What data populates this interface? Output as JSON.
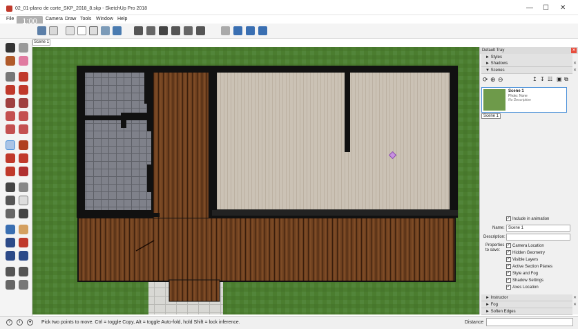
{
  "window": {
    "title": "02_01-plano de corte_SKP_2018_8.skp - SketchUp Pro 2018",
    "minimize": "—",
    "maximize": "☐",
    "close": "✕"
  },
  "timer": "1:00",
  "menu": [
    "File",
    "Camera",
    "Draw",
    "Tools",
    "Window",
    "Help"
  ],
  "scene_tab": "Scene 1",
  "tray": {
    "title": "Default Tray",
    "sections_top": [
      "Styles",
      "Shadows",
      "Scenes"
    ],
    "scene": {
      "name": "Scene 1",
      "photo_label": "Photo: None",
      "description": "No Description",
      "caption": "Scene 1"
    },
    "include_animation": "Include in animation",
    "name_label": "Name:",
    "name_value": "Scene 1",
    "description_label": "Description:",
    "properties_label": "Properties to save:",
    "properties": [
      "Camera Location",
      "Hidden Geometry",
      "Visible Layers",
      "Active Section Planes",
      "Style and Fog",
      "Shadow Settings",
      "Axes Location"
    ],
    "sections_bottom": [
      "Instructor",
      "Fog",
      "Soften Edges"
    ]
  },
  "status": {
    "message": "Pick two points to move.  Ctrl = toggle Copy, Alt = toggle Auto-fold, hold Shift = lock inference.",
    "distance_label": "Distance"
  },
  "colors": {
    "grass": "#4a7a30",
    "wall": "#121212",
    "deck_wood": "#6b3d1d",
    "floor_light": "#c9bfb2",
    "tile": "#7d7f86",
    "accent": "#4a90d9"
  }
}
